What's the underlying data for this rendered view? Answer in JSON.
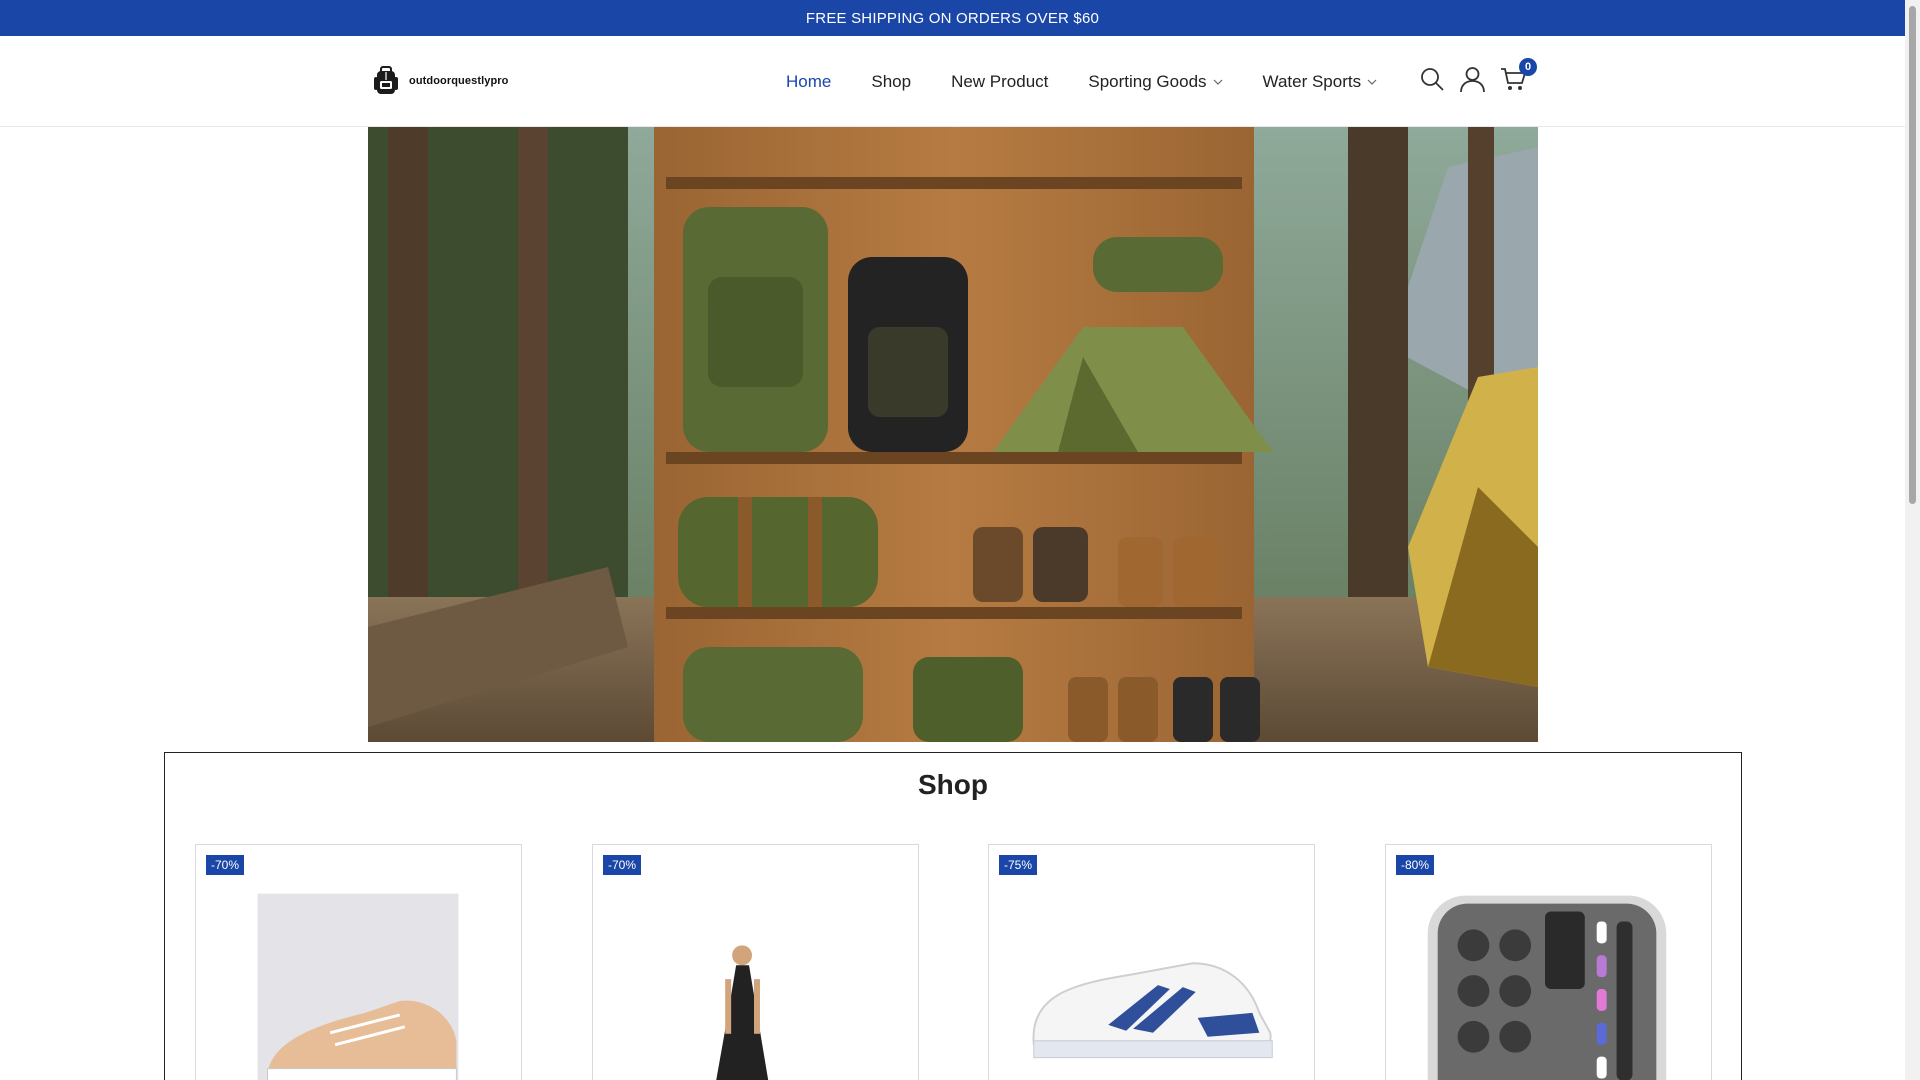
{
  "announcement": "FREE SHIPPING ON ORDERS OVER $60",
  "brand": {
    "name": "outdoorquestlypro"
  },
  "nav": [
    {
      "label": "Home",
      "active": true,
      "dropdown": false
    },
    {
      "label": "Shop",
      "active": false,
      "dropdown": false
    },
    {
      "label": "New Product",
      "active": false,
      "dropdown": false
    },
    {
      "label": "Sporting Goods",
      "active": false,
      "dropdown": true
    },
    {
      "label": "Water Sports",
      "active": false,
      "dropdown": true
    }
  ],
  "header_icons": [
    "search-icon",
    "user-icon",
    "cart-icon"
  ],
  "cart": {
    "count": "0"
  },
  "shop": {
    "title": "Shop",
    "products": [
      {
        "badge": "-70%",
        "image": "canvas-sneaker"
      },
      {
        "badge": "-70%",
        "image": "black-maxi-dress"
      },
      {
        "badge": "-75%",
        "image": "white-blue-sneaker"
      },
      {
        "badge": "-80%",
        "image": "foam-earplug-case"
      }
    ]
  },
  "colors": {
    "brand": "#1a46a8",
    "text": "#222222",
    "border": "#d9d9d9"
  }
}
